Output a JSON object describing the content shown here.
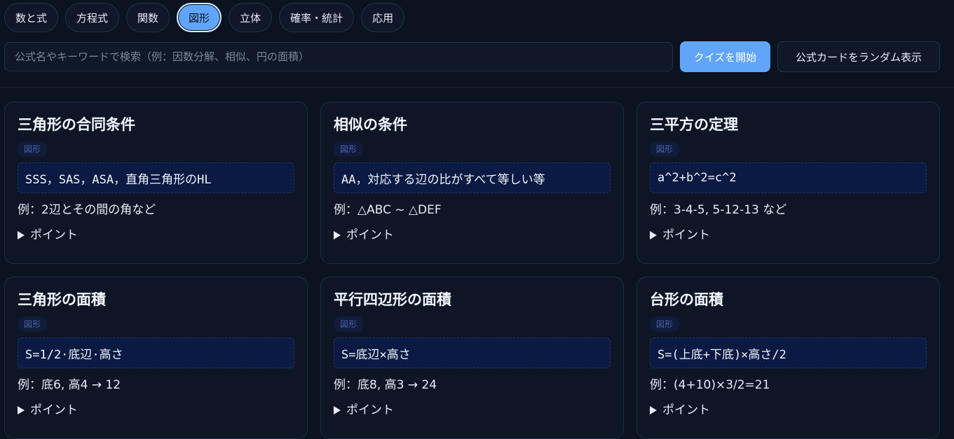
{
  "tabs": [
    {
      "label": "数と式",
      "active": false
    },
    {
      "label": "方程式",
      "active": false
    },
    {
      "label": "関数",
      "active": false
    },
    {
      "label": "図形",
      "active": true
    },
    {
      "label": "立体",
      "active": false
    },
    {
      "label": "確率・統計",
      "active": false
    },
    {
      "label": "応用",
      "active": false
    }
  ],
  "search": {
    "placeholder": "公式名やキーワードで検索（例：因数分解、相似、円の面積）",
    "value": ""
  },
  "buttons": {
    "quiz": "クイズを開始",
    "random": "公式カードをランダム表示"
  },
  "colors": {
    "background": "#0b1220",
    "accent": "#60a5fa",
    "card": "#0e1626",
    "formula_bg": "#0b1a42",
    "tag_text": "#4b5fb0"
  },
  "cards": [
    {
      "title": "三角形の合同条件",
      "tag": "図形",
      "formula": "SSS，SAS，ASA，直角三角形のHL",
      "example": "例：2辺とその間の角など",
      "point": "ポイント"
    },
    {
      "title": "相似の条件",
      "tag": "図形",
      "formula": "AA，対応する辺の比がすべて等しい等",
      "example": "例：△ABC ~ △DEF",
      "point": "ポイント"
    },
    {
      "title": "三平方の定理",
      "tag": "図形",
      "formula": "a^2+b^2=c^2",
      "example": "例：3-4-5, 5-12-13 など",
      "point": "ポイント"
    },
    {
      "title": "三角形の面積",
      "tag": "図形",
      "formula": "S=1/2·底辺·高さ",
      "example": "例：底6, 高4 → 12",
      "point": "ポイント"
    },
    {
      "title": "平行四辺形の面積",
      "tag": "図形",
      "formula": "S=底辺×高さ",
      "example": "例：底8, 高3 → 24",
      "point": "ポイント"
    },
    {
      "title": "台形の面積",
      "tag": "図形",
      "formula": "S=(上底+下底)×高さ/2",
      "example": "例：(4+10)×3/2=21",
      "point": "ポイント"
    }
  ]
}
